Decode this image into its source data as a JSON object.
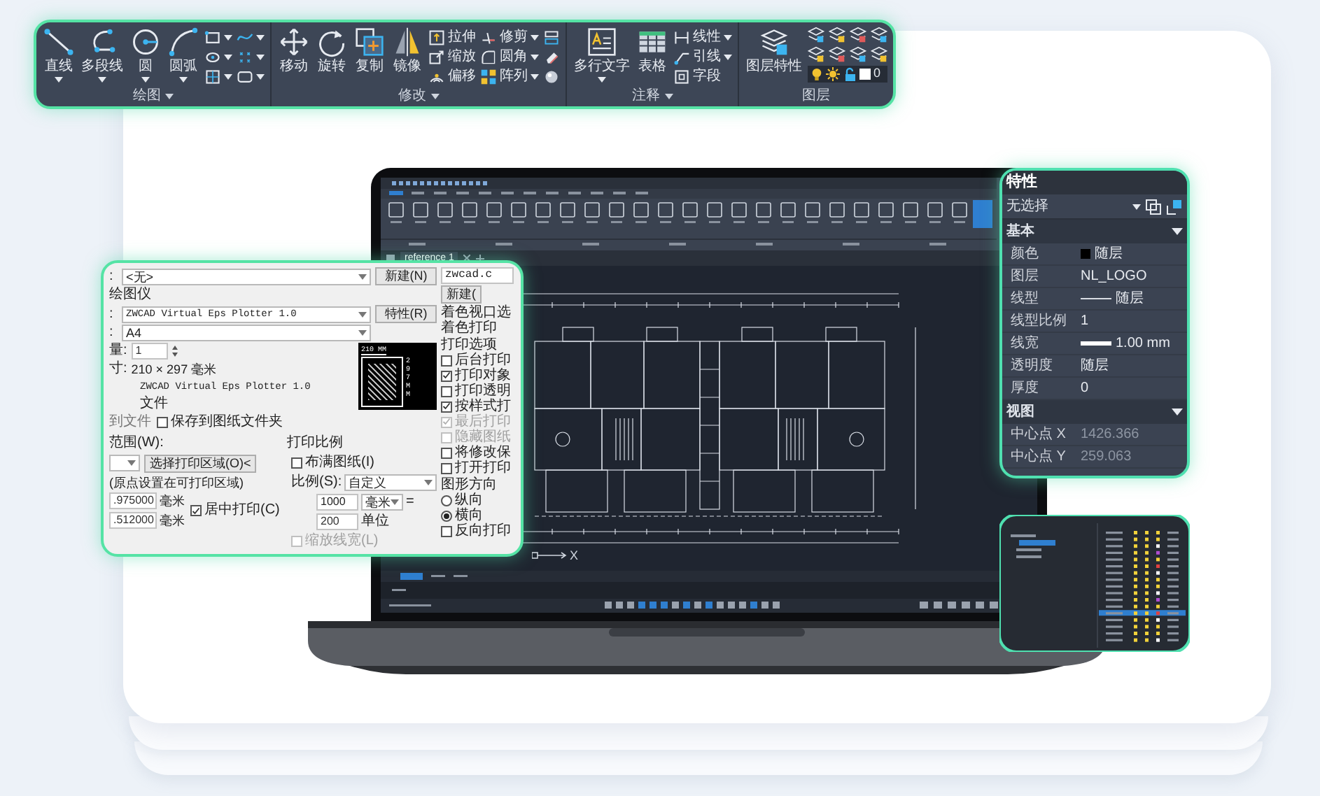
{
  "ribbon": {
    "groups": [
      {
        "label": "绘图",
        "dropdown": true,
        "large": [
          {
            "label": "直线",
            "dropdown": true
          },
          {
            "label": "多段线",
            "dropdown": true
          },
          {
            "label": "圆",
            "dropdown": true
          },
          {
            "label": "圆弧",
            "dropdown": true
          }
        ],
        "small": [
          {
            "dropdown": true
          },
          {
            "dropdown": true
          },
          {
            "dropdown": true
          },
          {
            "dropdown": true
          },
          {
            "dropdown": true
          },
          {
            "dropdown": true
          }
        ]
      },
      {
        "label": "修改",
        "dropdown": true,
        "large": [
          {
            "label": "移动",
            "dropdown": false
          },
          {
            "label": "旋转",
            "dropdown": false
          },
          {
            "label": "复制",
            "dropdown": false
          },
          {
            "label": "镜像",
            "dropdown": false
          }
        ],
        "small": [
          {
            "label": "拉伸",
            "dropdown": false
          },
          {
            "label": "缩放",
            "dropdown": false
          },
          {
            "label": "偏移",
            "dropdown": false
          },
          {
            "label": "修剪",
            "dropdown": true
          },
          {
            "label": "圆角",
            "dropdown": true
          },
          {
            "label": "阵列",
            "dropdown": true
          },
          {
            "dropdown": false
          },
          {
            "dropdown": false
          },
          {
            "dropdown": false
          }
        ]
      },
      {
        "label": "注释",
        "dropdown": true,
        "large": [
          {
            "label": "多行文字",
            "dropdown": true
          },
          {
            "label": "表格",
            "dropdown": false
          }
        ],
        "small": [
          {
            "label": "线性",
            "dropdown": true
          },
          {
            "label": "引线",
            "dropdown": true
          },
          {
            "label": "字段",
            "dropdown": false
          }
        ]
      },
      {
        "label": "图层",
        "dropdown": false,
        "large": [
          {
            "label": "图层特性",
            "dropdown": false
          }
        ],
        "layer_value": "0"
      }
    ]
  },
  "properties": {
    "title": "特性",
    "selection": "无选择",
    "sections": [
      {
        "title": "基本",
        "expanded": true,
        "rows": [
          {
            "label": "颜色",
            "value": "随层",
            "kind": "color",
            "disabled": false
          },
          {
            "label": "图层",
            "value": "NL_LOGO",
            "kind": "text",
            "disabled": false
          },
          {
            "label": "线型",
            "value": "随层",
            "kind": "linetype",
            "disabled": false
          },
          {
            "label": "线型比例",
            "value": "1",
            "kind": "text",
            "disabled": false
          },
          {
            "label": "线宽",
            "value": "1.00 mm",
            "kind": "lineweight",
            "disabled": false
          },
          {
            "label": "透明度",
            "value": "随层",
            "kind": "text",
            "disabled": false
          },
          {
            "label": "厚度",
            "value": "0",
            "kind": "text",
            "disabled": false
          }
        ]
      },
      {
        "title": "视图",
        "expanded": true,
        "rows": [
          {
            "label": "中心点 X",
            "value": "1426.366",
            "kind": "text",
            "disabled": true
          },
          {
            "label": "中心点 Y",
            "value": "259.063",
            "kind": "text",
            "disabled": true
          }
        ]
      }
    ]
  },
  "print_dialog": {
    "page_setup": {
      "label": ":",
      "value": "<无>",
      "button": "新建(N)"
    },
    "printer_heading": "绘图仪",
    "printer": {
      "label": ":",
      "value": "ZWCAD Virtual Eps Plotter 1.0",
      "button": "特性(R)"
    },
    "paper": {
      "label": ":",
      "value": "A4"
    },
    "copies": {
      "label": "量:",
      "value": "1"
    },
    "size": {
      "label": "寸:",
      "value": "210 × 297  毫米"
    },
    "plotter_line": "ZWCAD Virtual Eps Plotter 1.0",
    "location": "文件",
    "preview": {
      "width_label": "210 MM",
      "height_label": "297 MM"
    },
    "to_file_label": "到文件",
    "save_to_folder": {
      "label": "保存到图纸文件夹",
      "checked": false,
      "disabled": false
    },
    "area": {
      "label": "范围(W):",
      "button": "选择打印区域(O)<"
    },
    "offset": {
      "title": "(原点设置在可打印区域)",
      "x": {
        "value": ".975000",
        "unit": "毫米"
      },
      "y": {
        "value": ".512000",
        "unit": "毫米"
      },
      "center": {
        "label": "居中打印(C)",
        "checked": true,
        "disabled": false
      }
    },
    "scale": {
      "title": "打印比例",
      "fit": {
        "label": "布满图纸(I)",
        "checked": false,
        "disabled": false
      },
      "label": "比例(S):",
      "value": "自定义",
      "numerator": "1000",
      "unit": "毫米",
      "equals": "=",
      "denominator": "200",
      "denominator_unit": "单位",
      "lineweights": {
        "label": "缩放线宽(L)",
        "checked": false,
        "disabled": true
      }
    },
    "style_field": "zwcad.c",
    "style_button": "新建(",
    "shade_label": "着色视口选",
    "shade_print": "着色打印",
    "options_title": "打印选项",
    "options": [
      {
        "label": "后台打印",
        "checked": false,
        "disabled": false
      },
      {
        "label": "打印对象",
        "checked": true,
        "disabled": false
      },
      {
        "label": "打印透明",
        "checked": false,
        "disabled": false
      },
      {
        "label": "按样式打",
        "checked": true,
        "disabled": false
      },
      {
        "label": "最后打印",
        "checked": true,
        "disabled": true
      },
      {
        "label": "隐藏图纸",
        "checked": false,
        "disabled": true
      },
      {
        "label": "将修改保",
        "checked": false,
        "disabled": false
      },
      {
        "label": "打开打印",
        "checked": false,
        "disabled": false
      }
    ],
    "orientation": {
      "title": "图形方向",
      "options": [
        {
          "label": "纵向",
          "selected": false
        },
        {
          "label": "横向",
          "selected": true
        }
      ],
      "reverse": {
        "label": "反向打印",
        "checked": false,
        "disabled": false
      }
    }
  },
  "laptop_screen": {
    "document_tab": "reference 1",
    "axis_label": "X"
  }
}
